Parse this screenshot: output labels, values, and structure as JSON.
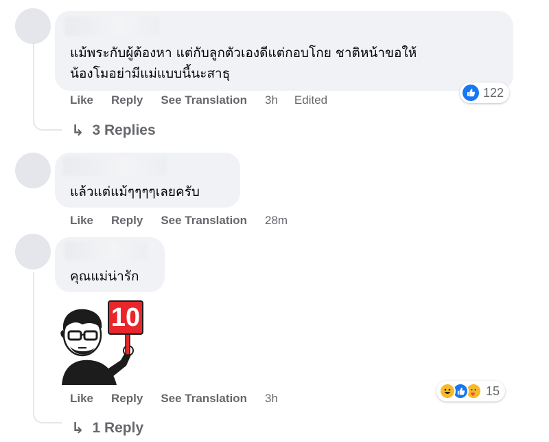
{
  "comments": [
    {
      "text_line1": "แม้พระกับผู้ต้องหา แต่กับลูกตัวเองดีแต่กอบโกย ชาติหน้าขอให้",
      "text_line2": "น้องโมอย่ามีแม่แบบนี้นะสาธุ",
      "actions": {
        "like": "Like",
        "reply": "Reply",
        "translate": "See Translation",
        "time": "3h",
        "edited": "Edited"
      },
      "reaction_count": "122",
      "replies_label": "3 Replies"
    },
    {
      "text_line1": "แล้วแต่แม้ๆๆๆๆเลยครับ",
      "actions": {
        "like": "Like",
        "reply": "Reply",
        "translate": "See Translation",
        "time": "28m"
      }
    },
    {
      "text_line1": "คุณแม่น่ารัก",
      "sticker_number": "10",
      "actions": {
        "like": "Like",
        "reply": "Reply",
        "translate": "See Translation",
        "time": "3h"
      },
      "reaction_count": "15",
      "replies_label": "1 Reply"
    }
  ],
  "icons": {
    "reply_arrow": "reply-arrow-icon",
    "reactions_1": [
      "like-icon"
    ],
    "reactions_3": [
      "haha-icon",
      "like-icon",
      "care-icon"
    ]
  },
  "colors": {
    "bubble": "#f0f2f5",
    "secondary_text": "#65676b",
    "like_blue": "#1877f2",
    "sticker_red": "#e8262b"
  }
}
